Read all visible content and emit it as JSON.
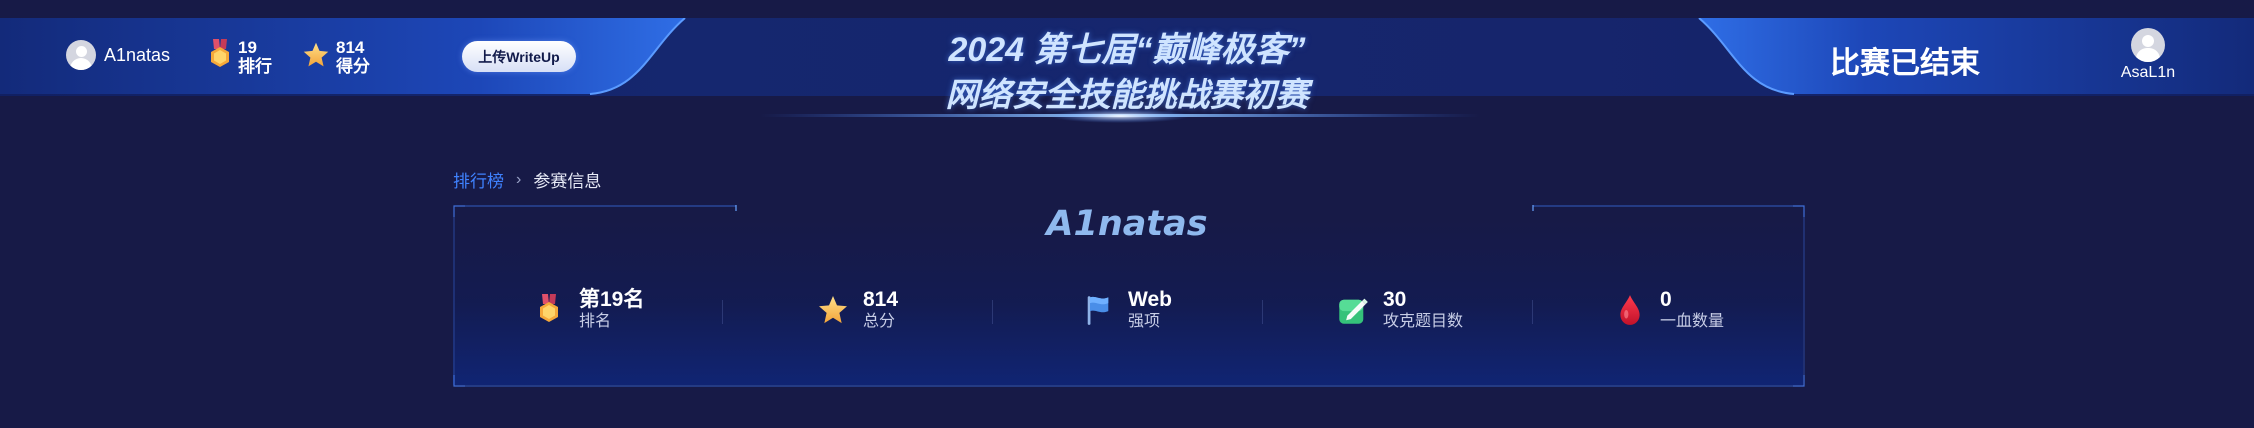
{
  "header": {
    "user_name": "A1natas",
    "rank_value": "19",
    "rank_label": "排行",
    "score_value": "814",
    "score_label": "得分",
    "upload_button": "上传WriteUp",
    "title_line1": "2024 第七届“巅峰极客”",
    "title_line2": "网络安全技能挑战赛初赛",
    "status": "比赛已结束",
    "account_name": "AsaL1n"
  },
  "breadcrumb": {
    "parent": "排行榜",
    "separator": "›",
    "current": "参赛信息"
  },
  "team": {
    "name": "A1natas"
  },
  "stats": [
    {
      "icon": "medal-icon",
      "value": "第19名",
      "label": "排名"
    },
    {
      "icon": "star-icon",
      "value": "814",
      "label": "总分"
    },
    {
      "icon": "flag-icon",
      "value": "Web",
      "label": "强项"
    },
    {
      "icon": "edit-check-icon",
      "value": "30",
      "label": "攻克题目数"
    },
    {
      "icon": "blood-drop-icon",
      "value": "0",
      "label": "一血数量"
    }
  ],
  "colors": {
    "background": "#171a47",
    "link": "#3f82ff",
    "team_name": "#8fb9ee"
  }
}
